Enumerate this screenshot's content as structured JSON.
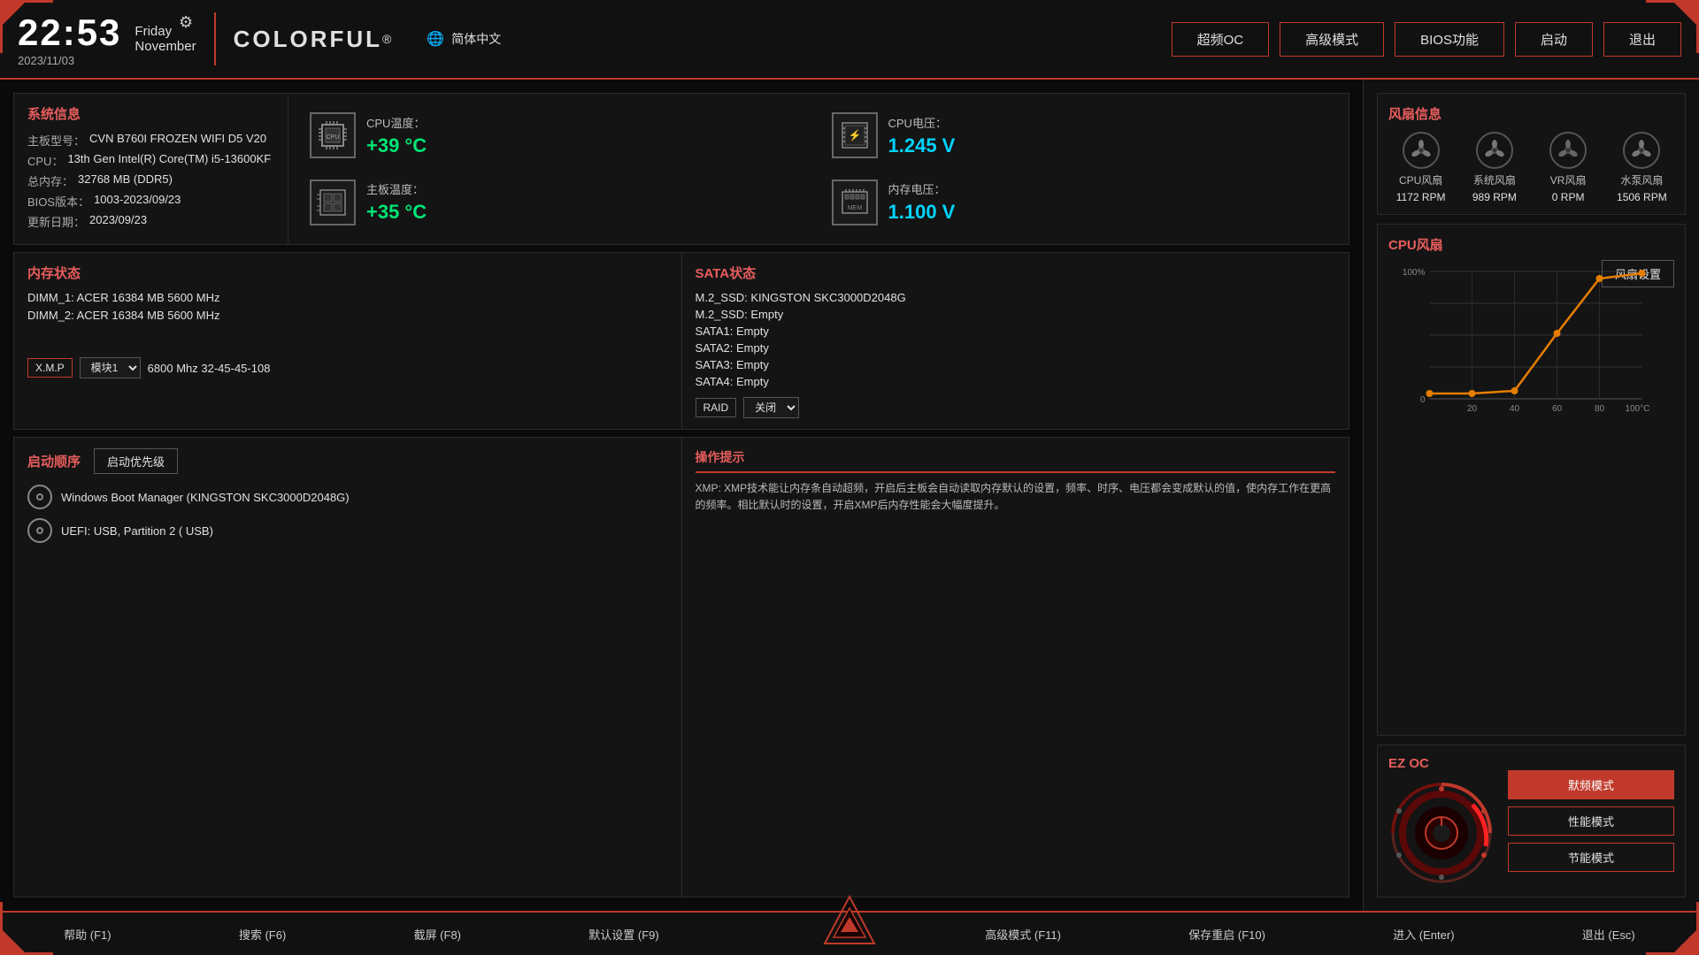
{
  "header": {
    "time": "22:53",
    "date": "2023/11/03",
    "day": "Friday",
    "month": "November",
    "logo": "COLORFUL",
    "logo_reg": "®",
    "lang_icon": "🌐",
    "lang": "简体中文",
    "buttons": [
      {
        "label": "超频OC",
        "id": "oc"
      },
      {
        "label": "高级模式",
        "id": "advanced"
      },
      {
        "label": "BIOS功能",
        "id": "bios"
      },
      {
        "label": "启动",
        "id": "boot"
      },
      {
        "label": "退出",
        "id": "exit"
      }
    ]
  },
  "sysinfo": {
    "title": "系统信息",
    "board_label": "主板型号：",
    "board_value": "CVN B760I FROZEN WIFI D5 V20",
    "cpu_label": "CPU：",
    "cpu_value": "13th Gen Intel(R) Core(TM) i5-13600KF",
    "ram_label": "总内存：",
    "ram_value": "32768 MB (DDR5)",
    "bios_label": "BIOS版本：",
    "bios_value": "1003-2023/09/23",
    "update_label": "更新日期：",
    "update_value": "2023/09/23"
  },
  "sensors": {
    "cpu_temp_label": "CPU温度：",
    "cpu_temp_value": "+39 °C",
    "board_temp_label": "主板温度：",
    "board_temp_value": "+35 °C",
    "cpu_volt_label": "CPU电压：",
    "cpu_volt_value": "1.245 V",
    "mem_volt_label": "内存电压：",
    "mem_volt_value": "1.100 V"
  },
  "memory": {
    "title": "内存状态",
    "dimm1": "DIMM_1: ACER 16384 MB 5600 MHz",
    "dimm2": "DIMM_2: ACER 16384 MB 5600 MHz",
    "xmp_label": "X.M.P",
    "module_option": "模块1",
    "xmp_value": "6800 Mhz 32-45-45-108"
  },
  "sata": {
    "title": "SATA状态",
    "items": [
      "M.2_SSD: KINGSTON SKC3000D2048G",
      "M.2_SSD: Empty",
      "SATA1: Empty",
      "SATA2: Empty",
      "SATA3: Empty",
      "SATA4: Empty"
    ],
    "raid_label": "RAID",
    "raid_value": "关闭"
  },
  "boot": {
    "title": "启动顺序",
    "priority_btn": "启动优先级",
    "items": [
      "Windows Boot Manager (KINGSTON SKC3000D2048G)",
      "UEFI:  USB, Partition 2 ( USB)"
    ]
  },
  "operation_hint": {
    "title": "操作提示",
    "text": "XMP: XMP技术能让内存条自动超频，开启后主板会自动读取内存默认的设置，频率、时序、电压都会变成默认的值，使内存工作在更高的频率。相比默认时的设置，开启XMP后内存性能会大幅度提升。"
  },
  "fan_info": {
    "title": "风扇信息",
    "fans": [
      {
        "name": "CPU风扇",
        "rpm": "1172 RPM"
      },
      {
        "name": "系统风扇",
        "rpm": "989 RPM"
      },
      {
        "name": "VR风扇",
        "rpm": "0 RPM"
      },
      {
        "name": "水泵风扇",
        "rpm": "1506 RPM"
      }
    ]
  },
  "cpu_fan": {
    "title": "CPU风扇",
    "settings_btn": "风扇设置",
    "y_max": "100%",
    "y_min": "0",
    "x_labels": [
      "20",
      "40",
      "60",
      "80",
      "100°C"
    ]
  },
  "ezoc": {
    "title": "EZ OC",
    "buttons": [
      {
        "label": "默频模式",
        "active": true
      },
      {
        "label": "性能模式",
        "active": false
      },
      {
        "label": "节能模式",
        "active": false
      }
    ]
  },
  "bottom_bar": {
    "items": [
      {
        "label": "帮助 (F1)"
      },
      {
        "label": "搜索 (F6)"
      },
      {
        "label": "截屏 (F8)"
      },
      {
        "label": "默认设置 (F9)"
      },
      {
        "label": "高级模式 (F11)"
      },
      {
        "label": "保存重启 (F10)"
      },
      {
        "label": "进入 (Enter)"
      },
      {
        "label": "退出 (Esc)"
      }
    ]
  }
}
